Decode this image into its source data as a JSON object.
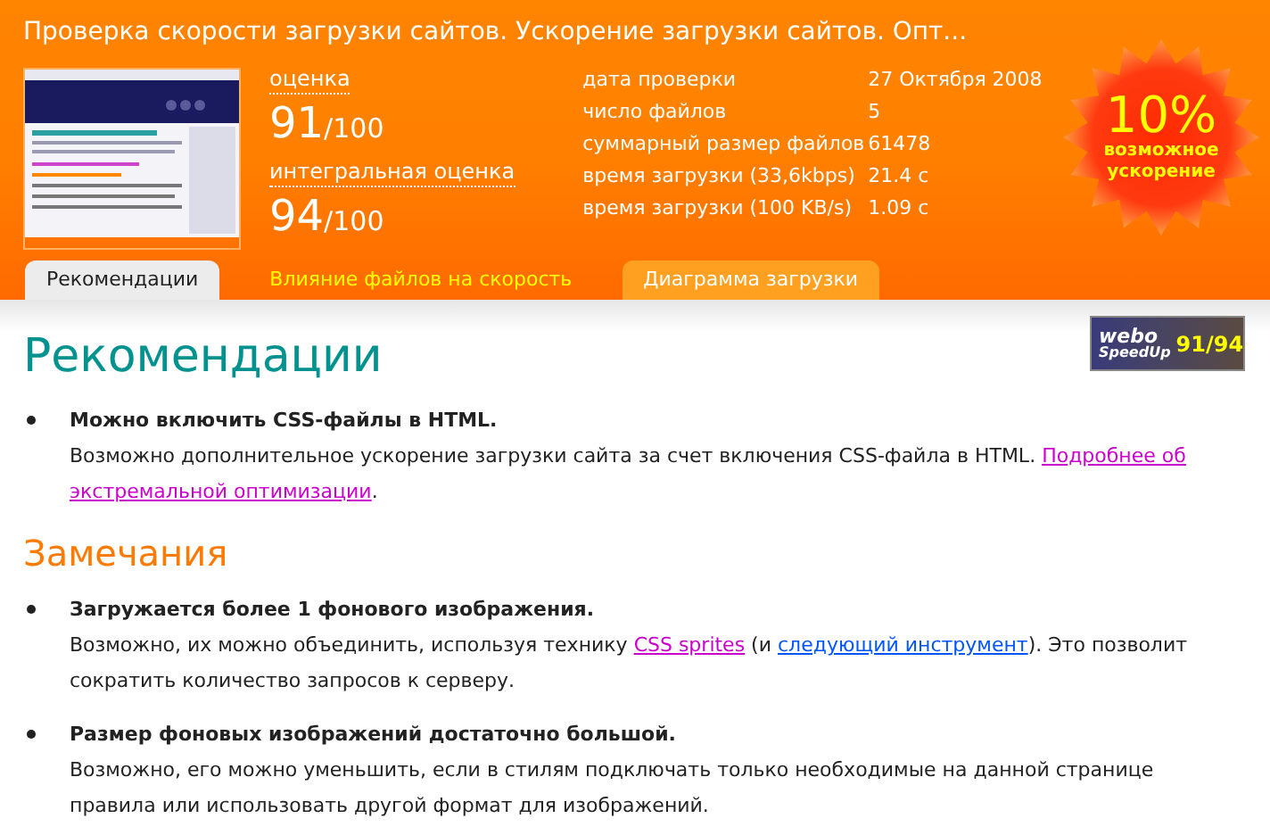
{
  "header": {
    "title": "Проверка скорости загрузки сайтов. Ускорение загрузки сайтов. Опт...",
    "scores": [
      {
        "label": "оценка",
        "value": "91",
        "max": "/100"
      },
      {
        "label": "интегральная оценка",
        "value": "94",
        "max": "/100"
      }
    ],
    "stats": [
      {
        "label": "дата проверки",
        "value": "27 Октября 2008"
      },
      {
        "label": "число файлов",
        "value": "5"
      },
      {
        "label": "суммарный размер файлов",
        "value": "61478"
      },
      {
        "label": "время загрузки (33,6kbps)",
        "value": "21.4 с"
      },
      {
        "label": "время загрузки (100 KB/s)",
        "value": "1.09 с"
      }
    ],
    "speedup": {
      "percent": "10%",
      "caption": "возможное ускорение"
    }
  },
  "tabs": [
    {
      "label": "Рекомендации",
      "selected": true,
      "kind": "tab"
    },
    {
      "label": "Влияние файлов на скорость",
      "selected": false,
      "kind": "plain"
    },
    {
      "label": "Диаграмма загрузки",
      "selected": false,
      "kind": "tab"
    }
  ],
  "badge": {
    "logo": "webo",
    "sub": "SpeedUp",
    "score": "91/94"
  },
  "sections": [
    {
      "heading": "Рекомендации",
      "kind": "recommendation",
      "items": [
        {
          "title": "Можно включить CSS-файлы в HTML.",
          "parts": [
            {
              "text": "Возможно дополнительное ускорение загрузки сайта за счет включения CSS-файла в HTML. "
            },
            {
              "text": "Подробнее об",
              "link": true,
              "visited": true
            },
            {
              "text": "экстремальной оптимизации",
              "link": true,
              "visited": true
            },
            {
              "text": "."
            }
          ]
        }
      ]
    },
    {
      "heading": "Замечания",
      "kind": "warning",
      "items": [
        {
          "title": "Загружается более 1 фонового изображения.",
          "parts": [
            {
              "text": "Возможно, их можно объединить, используя технику "
            },
            {
              "text": "CSS sprites",
              "link": true,
              "visited": true
            },
            {
              "text": " (и "
            },
            {
              "text": "следующий инструмент",
              "link": true,
              "visited": false
            },
            {
              "text": "). Это позволит сократить количество запросов к серверу."
            }
          ]
        },
        {
          "title": "Размер фоновых изображений достаточно большой.",
          "parts": [
            {
              "text": "Возможно, его можно уменьшить, если в стилям подключать только необходимые на данной странице правила или использовать другой формат для изображений."
            }
          ]
        }
      ]
    }
  ]
}
